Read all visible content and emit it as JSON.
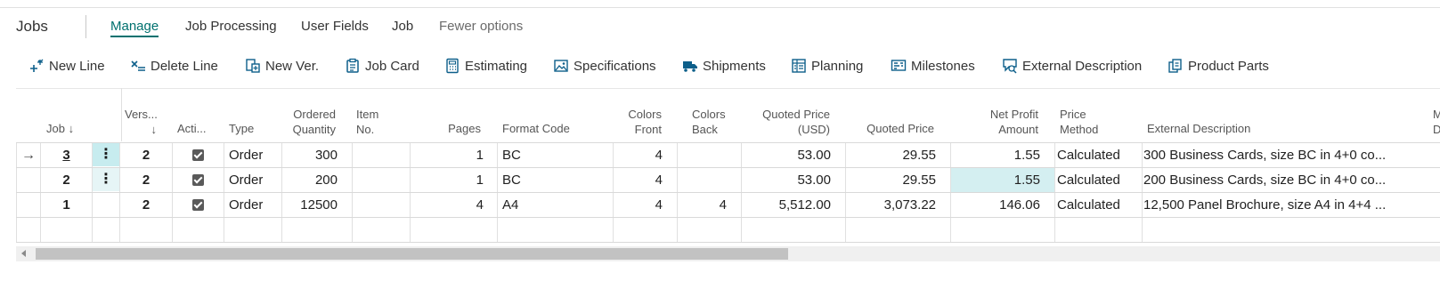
{
  "header": {
    "title": "Jobs",
    "tabs": [
      {
        "label": "Manage"
      },
      {
        "label": "Job Processing"
      },
      {
        "label": "User Fields"
      },
      {
        "label": "Job"
      },
      {
        "label": "Fewer options"
      }
    ]
  },
  "actions": [
    {
      "label": "New Line",
      "icon": "new-line-icon"
    },
    {
      "label": "Delete Line",
      "icon": "delete-line-icon"
    },
    {
      "label": "New Ver.",
      "icon": "new-version-icon"
    },
    {
      "label": "Job Card",
      "icon": "job-card-icon"
    },
    {
      "label": "Estimating",
      "icon": "calculator-icon"
    },
    {
      "label": "Specifications",
      "icon": "image-icon"
    },
    {
      "label": "Shipments",
      "icon": "truck-icon"
    },
    {
      "label": "Planning",
      "icon": "planning-icon"
    },
    {
      "label": "Milestones",
      "icon": "milestones-icon"
    },
    {
      "label": "External Description",
      "icon": "external-description-icon"
    },
    {
      "label": "Product Parts",
      "icon": "product-parts-icon"
    }
  ],
  "grid": {
    "columns": {
      "job": "Job",
      "job_sort": "↓",
      "version_1": "Vers...",
      "version_2": "↓",
      "active": "Acti...",
      "type": "Type",
      "ordered_qty_1": "Ordered",
      "ordered_qty_2": "Quantity",
      "item_no_1": "Item",
      "item_no_2": "No.",
      "pages": "Pages",
      "format_code": "Format Code",
      "colors_front_1": "Colors",
      "colors_front_2": "Front",
      "colors_back_1": "Colors",
      "colors_back_2": "Back",
      "quoted_price_usd_1": "Quoted Price",
      "quoted_price_usd_2": "(USD)",
      "quoted_price": "Quoted Price",
      "net_profit_1": "Net Profit",
      "net_profit_2": "Amount",
      "price_method_1": "Price",
      "price_method_2": "Method",
      "external_description": "External Description",
      "cut_1": "M",
      "cut_2": "D"
    },
    "rows": [
      {
        "indicator": "→",
        "job": "3",
        "version": "2",
        "active": true,
        "type": "Order",
        "ordered_qty": "300",
        "item_no": "",
        "pages": "1",
        "format_code": "BC",
        "colors_front": "4",
        "colors_back": "",
        "quoted_price_usd": "53.00",
        "quoted_price": "29.55",
        "net_profit": "1.55",
        "price_method": "Calculated",
        "external_description": "300 Business Cards, size BC  in 4+0 co..."
      },
      {
        "indicator": "",
        "job": "2",
        "version": "2",
        "active": true,
        "type": "Order",
        "ordered_qty": "200",
        "item_no": "",
        "pages": "1",
        "format_code": "BC",
        "colors_front": "4",
        "colors_back": "",
        "quoted_price_usd": "53.00",
        "quoted_price": "29.55",
        "net_profit": "1.55",
        "price_method": "Calculated",
        "external_description": "200 Business Cards, size BC  in 4+0 co..."
      },
      {
        "indicator": "",
        "job": "1",
        "version": "2",
        "active": true,
        "type": "Order",
        "ordered_qty": "12500",
        "item_no": "",
        "pages": "4",
        "format_code": "A4",
        "colors_front": "4",
        "colors_back": "4",
        "quoted_price_usd": "5,512.00",
        "quoted_price": "3,073.22",
        "net_profit": "146.06",
        "price_method": "Calculated",
        "external_description": "12,500 Panel Brochure, size A4 in 4+4 ..."
      }
    ],
    "row_menu": "⋮"
  },
  "colors": {
    "accent": "#00716f",
    "selected_cell": "#c7ecef",
    "highlight_cell": "#d4eff1"
  }
}
